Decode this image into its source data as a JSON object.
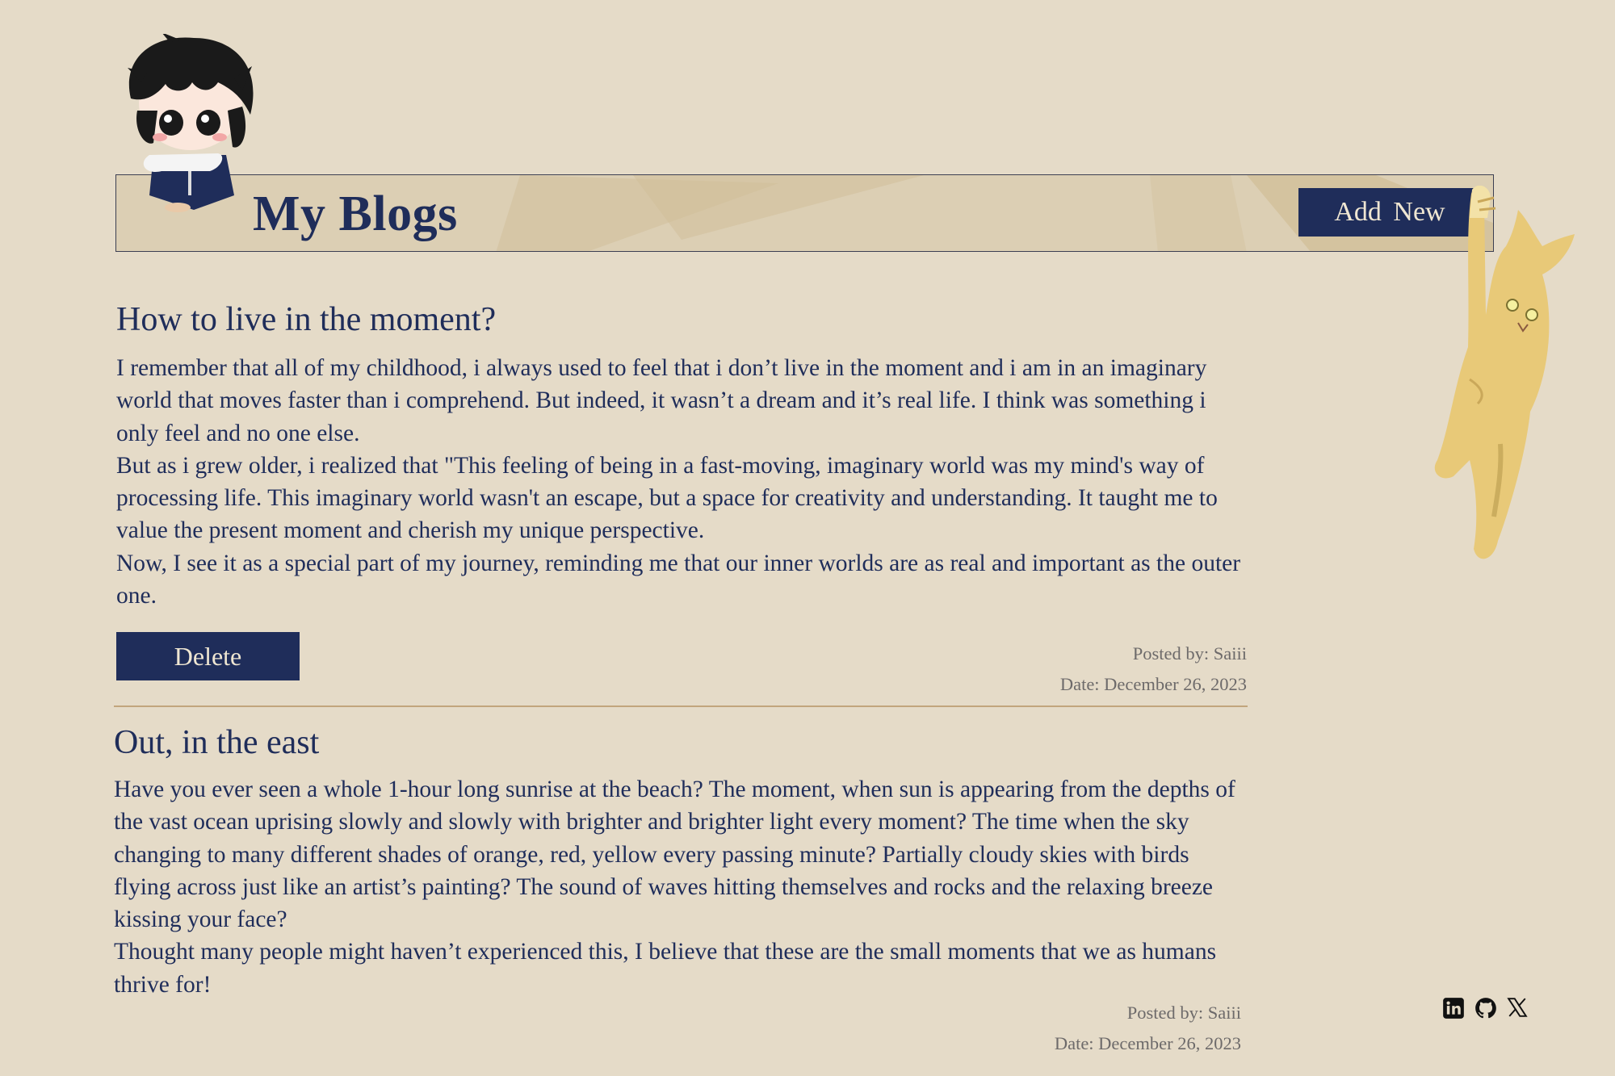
{
  "header": {
    "title": "My Blogs",
    "add_label": "Add  New"
  },
  "posts": [
    {
      "title": "How to live in the moment?",
      "paragraphs": [
        "I remember that all of my childhood, i always used to feel that i don’t live in the moment and i am in an imaginary world that moves faster than i comprehend. But indeed, it wasn’t a dream and it’s real life. I think was something i only feel and no one else.",
        "But as i grew older, i realized that \"This feeling of being in a fast-moving, imaginary world was my mind's way of processing life. This imaginary world wasn't an escape, but a space for  creativity and understanding. It taught me to value the present moment and cherish my unique perspective.",
        "Now, I see it as a special part of my journey, reminding me that our inner worlds are as real and important as the outer one."
      ],
      "delete_label": "Delete",
      "posted_by": "Posted by: Saiii",
      "date": "Date: December 26, 2023"
    },
    {
      "title": "Out, in the east",
      "paragraphs": [
        "Have you ever seen a whole 1-hour long sunrise at the beach? The moment, when sun is appearing from the depths of  the vast ocean uprising slowly and slowly with brighter and brighter light every moment?  The time when the sky changing to many different shades of orange, red, yellow every passing minute? Partially cloudy skies with birds flying across just like an artist’s painting? The sound of waves hitting themselves and rocks and the relaxing breeze kissing your face?",
        "Thought many people might haven’t experienced this, I believe that these are the small moments that we as humans thrive for!"
      ],
      "posted_by": "Posted by: Saiii",
      "date": "Date: December 26, 2023"
    }
  ],
  "socials": [
    "linkedin-icon",
    "github-icon",
    "x-icon"
  ],
  "colors": {
    "background": "#e5dbc8",
    "accent": "#1f2d5a",
    "header_bar": "#dccfb4",
    "divider": "#c2a57d",
    "meta_text": "#6d6a6a"
  }
}
